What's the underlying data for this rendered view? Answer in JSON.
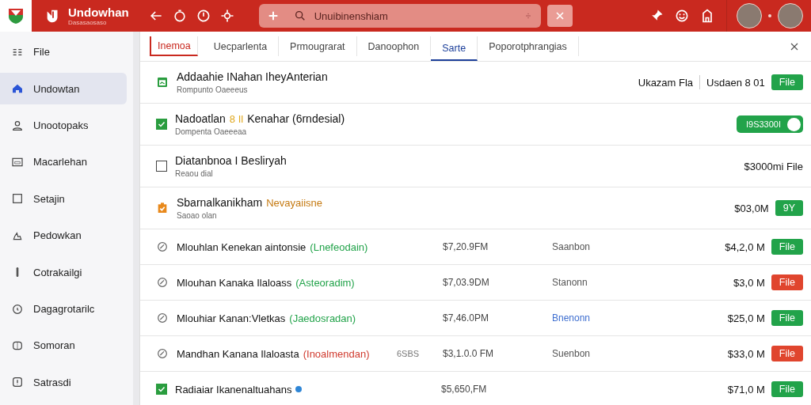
{
  "app": {
    "name": "Undowhan",
    "subtitle": "Dasasaosaso"
  },
  "search": {
    "value": "Unuibinenshiam"
  },
  "sidebar": {
    "items": [
      {
        "label": "File",
        "selected": false
      },
      {
        "label": "Undowtan",
        "selected": true
      },
      {
        "label": "Unootopaks",
        "selected": false
      },
      {
        "label": "Macarlehan",
        "selected": false
      },
      {
        "label": "Setajin",
        "selected": false
      },
      {
        "label": "Pedowkan",
        "selected": false
      },
      {
        "label": "Cotrakailgi",
        "selected": false
      },
      {
        "label": "Dagagrotarilc",
        "selected": false
      },
      {
        "label": "Somoran",
        "selected": false
      },
      {
        "label": "Satrasdi",
        "selected": false
      }
    ]
  },
  "tabs": [
    {
      "label": "Inemoa",
      "selected": false,
      "flagged": true
    },
    {
      "label": "Uecparlenta",
      "selected": false,
      "flagged": false
    },
    {
      "label": "Prmougrarat",
      "selected": false,
      "flagged": false
    },
    {
      "label": "Danoophon",
      "selected": false,
      "flagged": false
    },
    {
      "label": "Sarte",
      "selected": true,
      "flagged": false
    },
    {
      "label": "Poporotphrangias",
      "selected": false,
      "flagged": false
    }
  ],
  "rows": [
    {
      "kind": "calendar",
      "title": "Addaahie INahan IheyAnterian",
      "subtitle": "Rompunto Oaeeeus",
      "trail": [
        {
          "kind": "text",
          "text": "Ukazam Fla"
        },
        {
          "kind": "rule"
        },
        {
          "kind": "text",
          "text": "Usdaen 8 01"
        },
        {
          "kind": "button",
          "label": "File",
          "color": "#22a34a"
        }
      ]
    },
    {
      "kind": "checkbox",
      "checked": true,
      "title": "Nadoatlan",
      "tag": {
        "text": "8 Il",
        "color": "#e0a81e"
      },
      "title_rest": "Kenahar (6rndesial)",
      "subtitle": "Dompenta Oaeeeaa",
      "trail": [
        {
          "kind": "toggle",
          "label": "I9S3300I",
          "on": true
        }
      ]
    },
    {
      "kind": "checkbox",
      "checked": false,
      "title": "Diatanbnoa I Besliryah",
      "subtitle": "Reaou dial",
      "trail": [
        {
          "kind": "text",
          "text": "$3000mi File"
        }
      ]
    },
    {
      "kind": "clipboard",
      "title": "Sbarnalkanikham",
      "tag": {
        "text": "Nevayaiisne",
        "color": "#c57a12"
      },
      "subtitle": "Saoao olan",
      "trail": [
        {
          "kind": "text",
          "text": "$03,0M"
        },
        {
          "kind": "button",
          "label": "9Y",
          "color": "#22a34a"
        }
      ]
    },
    {
      "kind": "circle",
      "title": "Mlouhlan Kenekan aintonsie",
      "tag": {
        "text": "(Lnefeodain)",
        "color": "#22a34a"
      },
      "time": "$7,20.9FM",
      "status": {
        "text": "Saanbon",
        "color": "#555555"
      },
      "trail": [
        {
          "kind": "text",
          "text": "$4,2,0 M"
        },
        {
          "kind": "button",
          "label": "File",
          "color": "#22a34a"
        }
      ]
    },
    {
      "kind": "circle",
      "title": "Mlouhan Kanaka Ilaloass",
      "tag": {
        "text": "(Asteoradim)",
        "color": "#22a34a"
      },
      "time": "$7,03.9DM",
      "status": {
        "text": "Stanonn",
        "color": "#555555"
      },
      "trail": [
        {
          "kind": "text",
          "text": "$3,0 M"
        },
        {
          "kind": "button",
          "label": "File",
          "color": "#e0452e"
        }
      ]
    },
    {
      "kind": "circle",
      "title": "Mlouhiar Kanan:Vletkas",
      "tag": {
        "text": "(Jaedosradan)",
        "color": "#22a34a"
      },
      "time": "$7,46.0PM",
      "status": {
        "text": "Bnenonn",
        "color": "#3f6fd0"
      },
      "trail": [
        {
          "kind": "text",
          "text": "$25,0 M"
        },
        {
          "kind": "button",
          "label": "File",
          "color": "#22a34a"
        }
      ]
    },
    {
      "kind": "circle",
      "title": "Mandhan Kanana Ilaloasta",
      "tag": {
        "text": "(Inoalmendan)",
        "color": "#d03a2e"
      },
      "extra": "6SBS",
      "time": "$3,1.0.0 FM",
      "status": {
        "text": "Suenbon",
        "color": "#555555"
      },
      "trail": [
        {
          "kind": "text",
          "text": "$33,0 M"
        },
        {
          "kind": "button",
          "label": "File",
          "color": "#e0452e"
        }
      ]
    },
    {
      "kind": "checkbox",
      "checked": true,
      "title": "Radiaiar Ikanenaltuahans",
      "info": true,
      "time": "$5,650,FM",
      "trail": [
        {
          "kind": "text",
          "text": "$71,0 M"
        },
        {
          "kind": "button",
          "label": "File",
          "color": "#22a34a"
        }
      ]
    }
  ]
}
